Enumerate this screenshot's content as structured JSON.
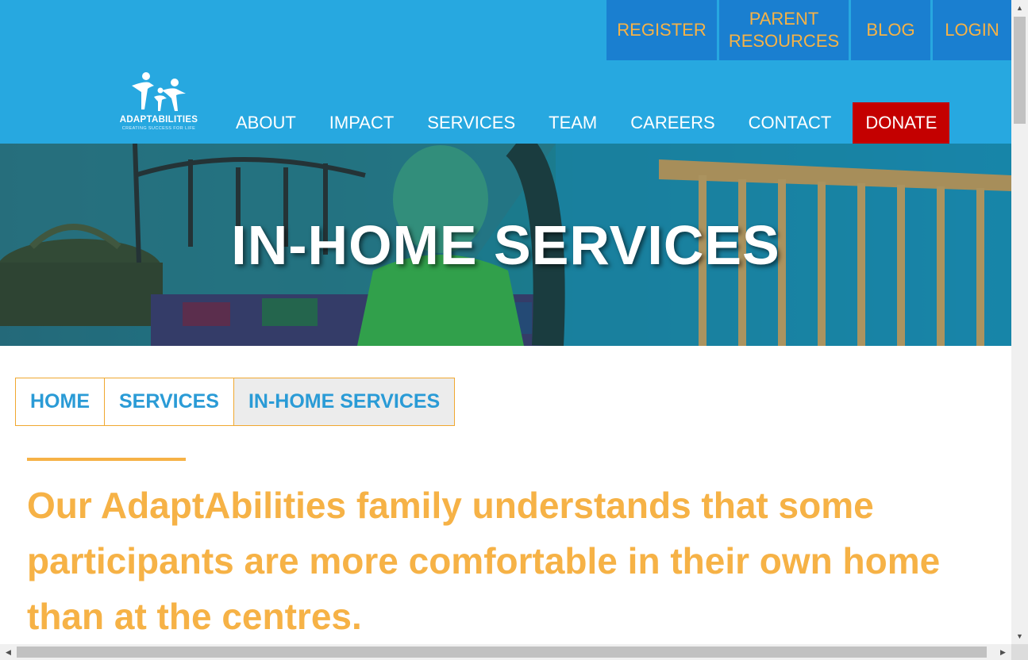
{
  "top_nav": {
    "register": "REGISTER",
    "parent_resources_line1": "PARENT",
    "parent_resources_line2": "RESOURCES",
    "blog": "BLOG",
    "login": "LOGIN"
  },
  "logo": {
    "name": "ADAPTABILITIES",
    "tagline": "CREATING SUCCESS FOR LIFE"
  },
  "main_nav": {
    "items": [
      "ABOUT",
      "IMPACT",
      "SERVICES",
      "TEAM",
      "CAREERS",
      "CONTACT"
    ],
    "donate": "DONATE"
  },
  "hero": {
    "title": "IN-HOME SERVICES"
  },
  "breadcrumb": [
    "HOME",
    "SERVICES",
    "IN-HOME SERVICES"
  ],
  "intro": "Our AdaptAbilities family understands that some participants are more comfortable in their own home than at the centres.",
  "colors": {
    "header_blue": "#27a8e0",
    "top_nav_blue": "#1a7fd0",
    "accent_orange": "#f6b246",
    "donate_red": "#c40000",
    "breadcrumb_blue": "#2a9bd6"
  },
  "scrollbars": {
    "up_arrow": "▲",
    "down_arrow": "▼",
    "left_arrow": "◀",
    "right_arrow": "▶"
  }
}
